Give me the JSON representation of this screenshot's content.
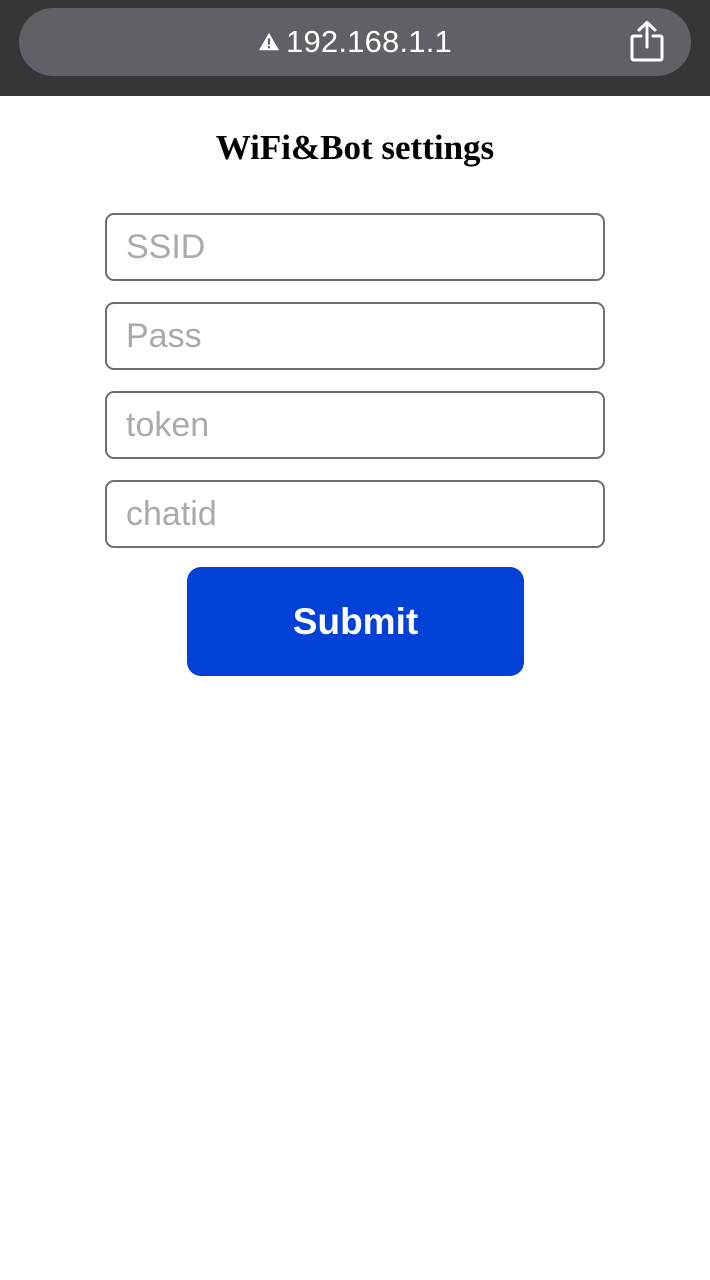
{
  "browser": {
    "url": "192.168.1.1",
    "warning_icon": "warning-triangle-icon",
    "share_icon": "share-icon"
  },
  "page": {
    "title": "WiFi&Bot settings"
  },
  "form": {
    "ssid_placeholder": "SSID",
    "pass_placeholder": "Pass",
    "token_placeholder": "token",
    "chatid_placeholder": "chatid",
    "submit_label": "Submit"
  },
  "colors": {
    "toolbar_bg": "#353638",
    "urlbar_bg": "#5f6167",
    "submit_bg": "#0241d8",
    "submit_text": "#ffffff"
  }
}
